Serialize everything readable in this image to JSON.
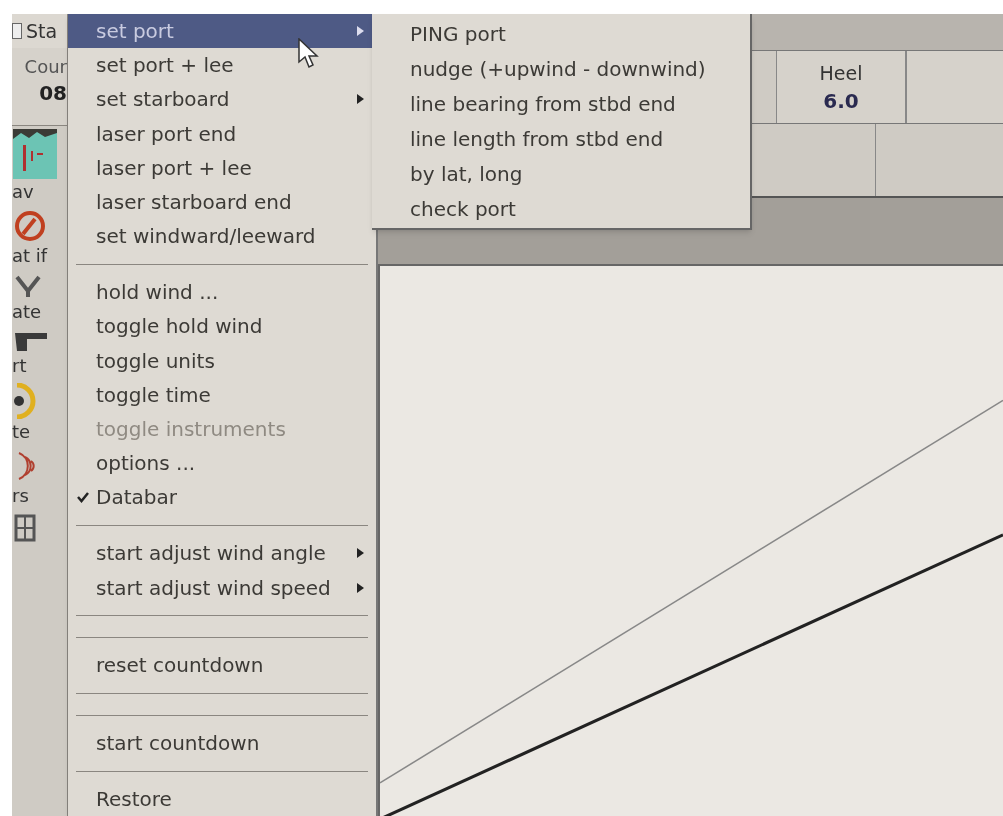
{
  "toolbar": {
    "items": [
      {
        "kind": "check",
        "label": "Sta",
        "checked": false
      },
      {
        "kind": "readout",
        "label": "Cour",
        "value": "08"
      },
      {
        "kind": "tool",
        "label": "av"
      },
      {
        "kind": "tool",
        "label": "at if"
      },
      {
        "kind": "tool",
        "label": "ate"
      },
      {
        "kind": "tool",
        "label": "rt"
      },
      {
        "kind": "tool",
        "label": "te"
      },
      {
        "kind": "tool",
        "label": "rs"
      },
      {
        "kind": "tool"
      }
    ]
  },
  "menu": {
    "items": [
      {
        "kind": "item",
        "label": "set port",
        "selected": true,
        "submenu": true,
        "disabled": false,
        "checked": false
      },
      {
        "kind": "item",
        "label": "set port + lee",
        "selected": false,
        "submenu": false,
        "disabled": false,
        "checked": false
      },
      {
        "kind": "item",
        "label": "set starboard",
        "selected": false,
        "submenu": true,
        "disabled": false,
        "checked": false
      },
      {
        "kind": "item",
        "label": "laser port end",
        "selected": false,
        "submenu": false,
        "disabled": false,
        "checked": false
      },
      {
        "kind": "item",
        "label": "laser port + lee",
        "selected": false,
        "submenu": false,
        "disabled": false,
        "checked": false
      },
      {
        "kind": "item",
        "label": "laser starboard end",
        "selected": false,
        "submenu": false,
        "disabled": false,
        "checked": false
      },
      {
        "kind": "item",
        "label": "set windward/leeward",
        "selected": false,
        "submenu": false,
        "disabled": false,
        "checked": false
      },
      {
        "kind": "separator"
      },
      {
        "kind": "item",
        "label": "hold wind ...",
        "selected": false,
        "submenu": false,
        "disabled": false,
        "checked": false
      },
      {
        "kind": "item",
        "label": "toggle hold wind",
        "selected": false,
        "submenu": false,
        "disabled": false,
        "checked": false
      },
      {
        "kind": "item",
        "label": "toggle units",
        "selected": false,
        "submenu": false,
        "disabled": false,
        "checked": false
      },
      {
        "kind": "item",
        "label": "toggle time",
        "selected": false,
        "submenu": false,
        "disabled": false,
        "checked": false
      },
      {
        "kind": "item",
        "label": "toggle instruments",
        "selected": false,
        "submenu": false,
        "disabled": true,
        "checked": false
      },
      {
        "kind": "item",
        "label": "options ...",
        "selected": false,
        "submenu": false,
        "disabled": false,
        "checked": false
      },
      {
        "kind": "item",
        "label": "Databar",
        "selected": false,
        "submenu": false,
        "disabled": false,
        "checked": true
      },
      {
        "kind": "separator"
      },
      {
        "kind": "item",
        "label": "start adjust wind angle",
        "selected": false,
        "submenu": true,
        "disabled": false,
        "checked": false
      },
      {
        "kind": "item",
        "label": "start adjust wind speed",
        "selected": false,
        "submenu": true,
        "disabled": false,
        "checked": false
      },
      {
        "kind": "separator"
      },
      {
        "kind": "separator"
      },
      {
        "kind": "item",
        "label": "reset countdown",
        "selected": false,
        "submenu": false,
        "disabled": false,
        "checked": false
      },
      {
        "kind": "separator"
      },
      {
        "kind": "separator"
      },
      {
        "kind": "item",
        "label": "start countdown",
        "selected": false,
        "submenu": false,
        "disabled": false,
        "checked": false
      },
      {
        "kind": "separator"
      },
      {
        "kind": "item",
        "label": "Restore",
        "selected": false,
        "submenu": false,
        "disabled": false,
        "checked": false
      }
    ]
  },
  "submenu": {
    "items": [
      {
        "label": "PING port"
      },
      {
        "label": "nudge (+upwind - downwind)"
      },
      {
        "label": "line bearing from stbd end"
      },
      {
        "label": "line length from stbd end"
      },
      {
        "label": "by lat, long"
      },
      {
        "label": "check port"
      }
    ]
  },
  "instruments": [
    {
      "label": "Heel",
      "value": "6.0"
    }
  ]
}
